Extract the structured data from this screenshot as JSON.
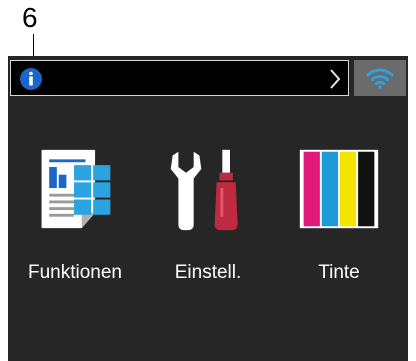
{
  "callout": {
    "number": "6"
  },
  "colors": {
    "screen_bg": "#262626",
    "info_blue": "#1c66c8",
    "wifi_blue": "#2aa3e0",
    "ink": {
      "magenta": "#e0197a",
      "cyan": "#1e9bd7",
      "yellow": "#f2e600",
      "black": "#111111"
    }
  },
  "status_bar": {
    "info_icon": "info-icon",
    "chevron_icon": "chevron-right-icon",
    "wifi_icon": "wifi-icon"
  },
  "tiles": [
    {
      "label": "Funktionen",
      "icon": "functions-icon"
    },
    {
      "label": "Einstell.",
      "icon": "settings-tools-icon"
    },
    {
      "label": "Tinte",
      "icon": "ink-cartridges-icon"
    }
  ]
}
